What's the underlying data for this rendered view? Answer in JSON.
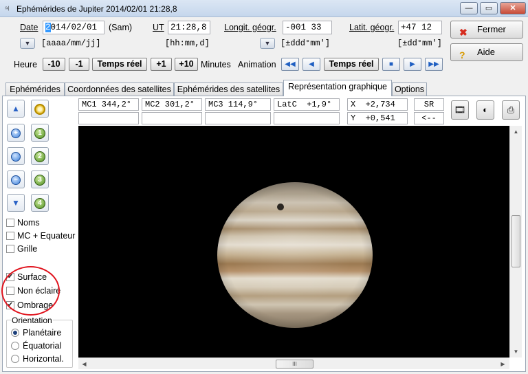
{
  "window": {
    "title": "Ephémérides de Jupiter  2014/02/01  21:28,8",
    "minimize": "—",
    "maximize": "▭",
    "close": "✕"
  },
  "inputs": {
    "date_label": "Date",
    "date_value": "2014/02/01",
    "date_day": "(Sam)",
    "date_format": "[aaaa/mm/jj]",
    "ut_label": "UT",
    "ut_value": "21:28,8",
    "ut_format": "[hh:mm,d]",
    "longitude_label": "Longit. géogr.",
    "longitude_value": "-001 33",
    "longitude_format": "[±ddd°mm']",
    "latitude_label": "Latit. géogr.",
    "latitude_value": "+47 12",
    "latitude_format": "[±dd°mm']"
  },
  "buttons": {
    "fermer": "Fermer",
    "aide": "Aide"
  },
  "time_controls": {
    "heure_label": "Heure",
    "minus10": "-10",
    "minus1": "-1",
    "temps_reel": "Temps réel",
    "plus1": "+1",
    "plus10": "+10",
    "minutes_label": "Minutes",
    "animation_label": "Animation",
    "anim_temps_reel": "Temps réel"
  },
  "tabs": [
    {
      "label": "Ephémérides"
    },
    {
      "label": "Coordonnées des satellites"
    },
    {
      "label": "Ephémérides des satellites"
    },
    {
      "label": "Représentation graphique"
    },
    {
      "label": "Options"
    }
  ],
  "readouts": {
    "mc1": "MC1 344,2°",
    "mc2": "MC2 301,2°",
    "mc3": "MC3 114,9°",
    "latc": "LatC  +1,9°",
    "x": "X  +2,734",
    "y": "Y  +0,541",
    "sr": "SR",
    "back": "<--"
  },
  "left_tools": {
    "zoom_buttons": [
      "1",
      "2",
      "3",
      "4"
    ]
  },
  "checkboxes": [
    {
      "label": "Noms",
      "checked": false
    },
    {
      "label": "MC + Equateur",
      "checked": false
    },
    {
      "label": "Grille",
      "checked": false
    },
    {
      "label": "Surface",
      "checked": true
    },
    {
      "label": "Non éclairé",
      "checked": false
    },
    {
      "label": "Ombrage",
      "checked": true
    }
  ],
  "orientation": {
    "legend": "Orientation",
    "options": [
      {
        "label": "Planétaire",
        "selected": true
      },
      {
        "label": "Équatorial",
        "selected": false
      },
      {
        "label": "Horizontal.",
        "selected": false
      }
    ]
  },
  "scroll": {
    "hthumb_grip": "III"
  },
  "colors": {
    "accent": "#1f5fc2",
    "highlight_circle": "#e0141e"
  }
}
